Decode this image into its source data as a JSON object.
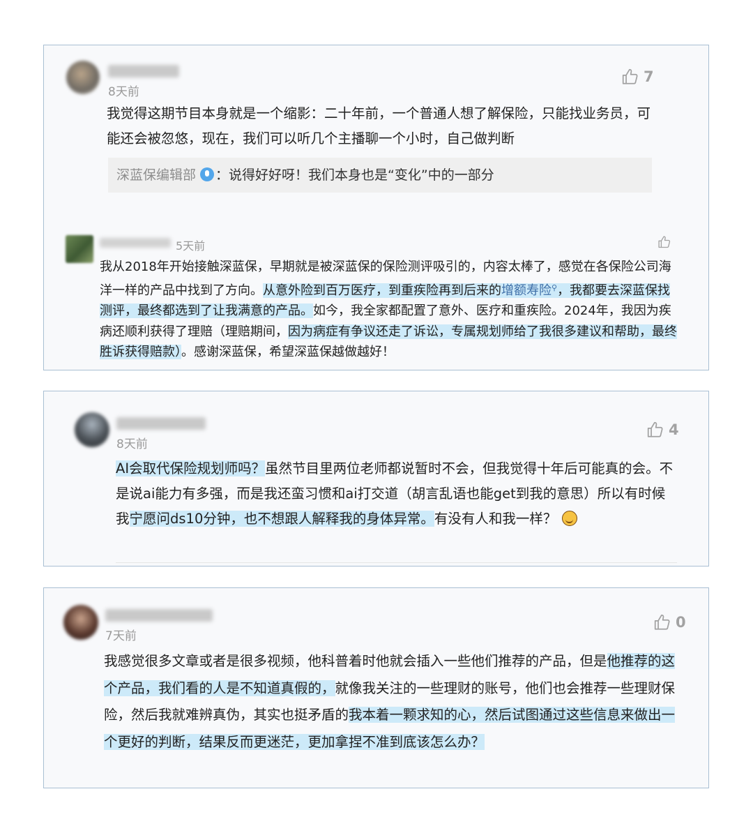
{
  "comments": [
    {
      "time": "8天前",
      "likes": "7",
      "text": "我觉得这期节目本身就是一个缩影：二十年前，一个普通人想了解保险，只能找业务员，可能还会被忽悠，现在，我们可以听几个主播聊一个小时，自己做判断",
      "reply": {
        "name": "深蓝保编辑部",
        "colon": "：",
        "text": "说得好好呀！我们本身也是“变化”中的一部分"
      }
    },
    {
      "time": "5天前",
      "segments": [
        "我从2018年开始接触深蓝保，早期就是被深蓝保的保险测评吸引的，内容太棒了，感觉在各保险公司海洋一样的产品中找到了方向。",
        "从意外险到百万医疗，到重疾险再到后来的",
        "增额寿险",
        "，我都要去深蓝保找测评，最终都选到了让我满意的产品。",
        "如今，我全家都配置了意外、医疗和重疾险。2024年，我因为疾病还顺利获得了理赔（理赔期间，",
        "因为病症有争议还走了诉讼，专属规划师给了我很多建议和帮助，最终胜诉获得赔款）",
        "。感谢深蓝保，希望深蓝保越做越好！"
      ]
    },
    {
      "time": "8天前",
      "likes": "4",
      "segments": [
        "AI会取代保险规划师吗？",
        "虽然节目里两位老师都说暂时不会，但我觉得十年后可能真的会。不是说ai能力有多强，而是我还蛮习惯和ai打交道（胡言乱语也能get到我的意思）所以有时候我",
        "宁愿问ds10分钟，也不想跟人解释我的身体异常。",
        "有没有人和我一样？"
      ]
    },
    {
      "time": "7天前",
      "likes": "0",
      "segments": [
        "我感觉很多文章或者是很多视频，他科普着时他就会插入一些他们推荐的产品，但是",
        "他推荐的这个产品，我们看的人是不知道真假的，",
        "就像我关注的一些理财的账号，他们也会推荐一些理财保险，然后我就难辨真伪，其实也挺矛盾的",
        "我本着一颗求知的心，然后试图通过这些信息来做出一个更好的判断，结果反而更迷茫，更加拿捏不准到底该怎么办？"
      ]
    }
  ],
  "icons": {
    "like": "thumbs-up-icon",
    "verified": "microphone-badge-icon",
    "emoji": "laughing-emoji-icon",
    "search": "search-icon"
  },
  "colors": {
    "highlight": "#cdeaf9",
    "card_border": "#a9bfd3",
    "link": "#3f6fa8",
    "muted": "#9a9a9a"
  }
}
